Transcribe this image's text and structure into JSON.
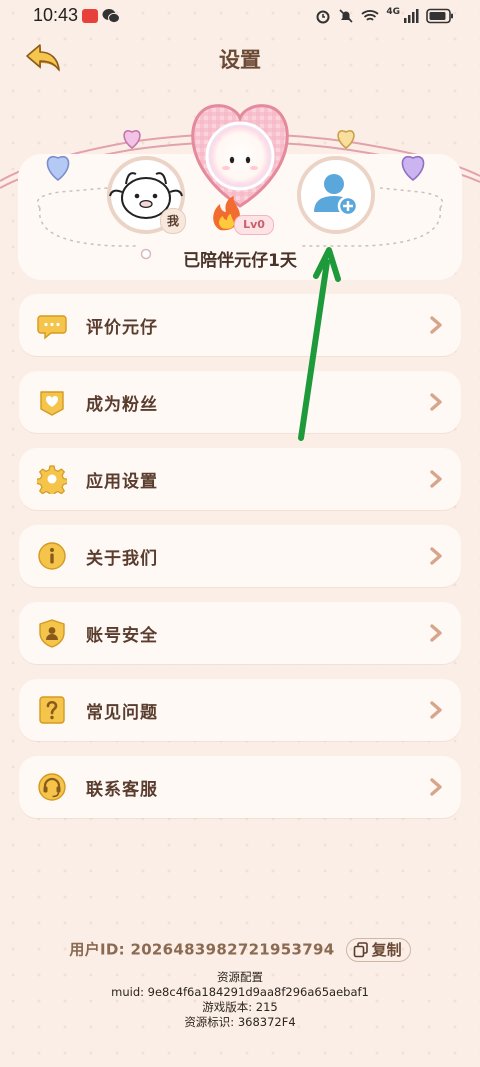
{
  "status_bar": {
    "time": "10:43",
    "network": "4G"
  },
  "header": {
    "title": "设置"
  },
  "hero": {
    "companion_text": "已陪伴元仔1天",
    "level": "Lv0",
    "me_tag": "我"
  },
  "menu": [
    {
      "label": "评价元仔",
      "icon": "chat-bubble-icon"
    },
    {
      "label": "成为粉丝",
      "icon": "heart-icon"
    },
    {
      "label": "应用设置",
      "icon": "gear-icon"
    },
    {
      "label": "关于我们",
      "icon": "info-icon"
    },
    {
      "label": "账号安全",
      "icon": "shield-icon"
    },
    {
      "label": "常见问题",
      "icon": "question-icon"
    },
    {
      "label": "联系客服",
      "icon": "headset-icon"
    }
  ],
  "footer": {
    "user_id": "用户ID: 2026483982721953794",
    "copy_label": "复制",
    "resource_config": "资源配置",
    "muid": "muid: 9e8c4f6a184291d9aa8f296a65aebaf1",
    "game_version": "游戏版本: 215",
    "resource_id": "资源标识: 368372F4"
  },
  "colors": {
    "background": "#fbeee6",
    "card": "#fff9f5",
    "icon_gold": "#f5c44a",
    "text_brown": "#5a3d2e",
    "arrow_annotation": "#1e9a3a"
  }
}
